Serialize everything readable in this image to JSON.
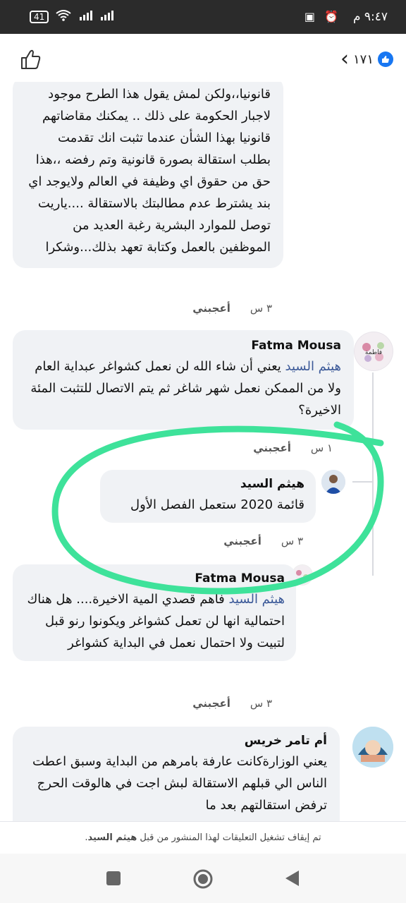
{
  "status": {
    "time": "٩:٤٧ م",
    "battery": "41"
  },
  "header": {
    "count": "١٧١"
  },
  "comments": {
    "c1": {
      "text": "قانونيا،،ولكن لمش يقول هذا الطرح موجود لاجبار الحكومة على ذلك .. يمكنك مقاضاتهم قانونيا بهذا الشأن عندما تثبت انك تقدمت بطلب استقالة بصورة قانونية وتم رفضه ،،هذا حق من حقوق اي وظيفة في العالم ولايوجد اي بند يشترط عدم مطالبتك بالاستقالة ....ياريت توصل للموارد البشرية رغبة العديد من الموظفين بالعمل وكتابة تعهد بذلك...وشكرا",
      "time": "٣ س",
      "like": "أعجبني"
    },
    "c2": {
      "name": "Fatma Mousa",
      "mention": "هيثم السيد",
      "text": " يعني أن شاء الله لن نعمل كشواغر عبداية العام ولا من الممكن نعمل شهر شاغر ثم يتم الاتصال للتثبت المئة الاخيرة؟",
      "time": "١ س",
      "like": "أعجبني"
    },
    "c3": {
      "name": "هيثم السيد",
      "text": "قائمة 2020 ستعمل الفصل الأول",
      "time": "٣ س",
      "like": "أعجبني"
    },
    "c4": {
      "name": "Fatma Mousa",
      "mention": "هيثم السيد",
      "text": " فاهم قصدي المية الاخيرة.... هل هناك احتمالية انها لن تعمل كشواغر ويكونوا رنو قبل لتبيت ولا احتمال نعمل في البداية كشواغر",
      "time": "٣ س",
      "like": "أعجبني"
    },
    "c5": {
      "name": "أم تامر خريس",
      "text": "يعني الوزارةكانت عارفة بامرهم من البداية وسبق اعطت الناس الي قبلهم الاستقالة لبش اجت في هالوقت الحرج ترفض استقالتهم بعد ما"
    }
  },
  "footer": {
    "note_prefix": "تم إيقاف تشغيل التعليقات لهذا المنشور من قبل ",
    "note_name": "هيثم السيد",
    "note_suffix": "."
  },
  "icons": {
    "like": "thumbs-up-icon",
    "back": "chevron-left-icon",
    "nav_square": "square-icon",
    "nav_home": "circle-icon",
    "nav_back": "triangle-back-icon"
  }
}
